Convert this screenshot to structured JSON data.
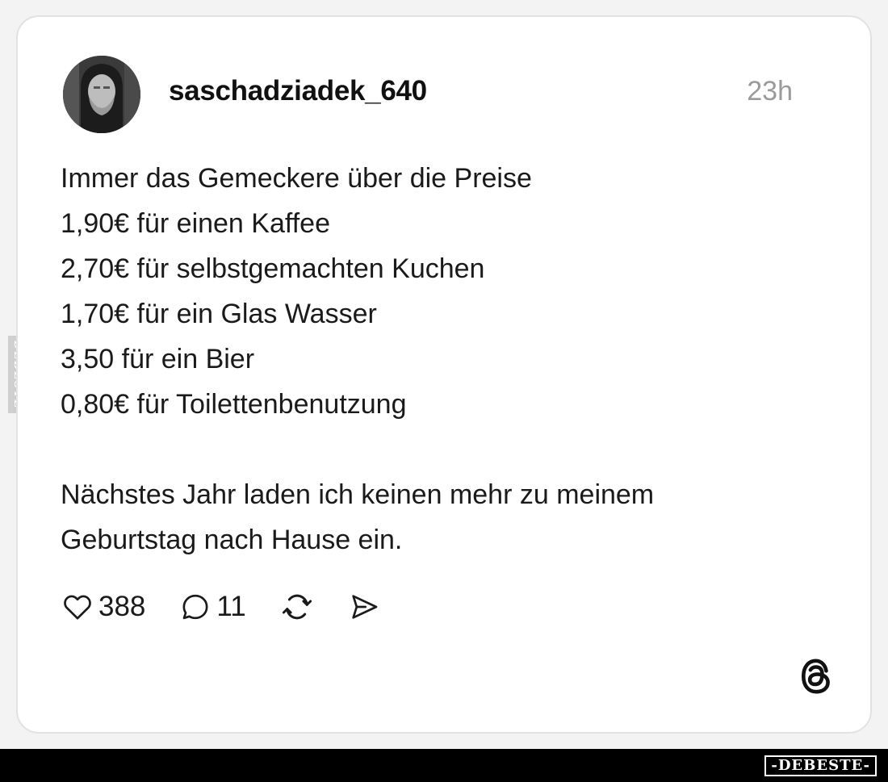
{
  "post": {
    "username": "saschadziadek_640",
    "timestamp": "23h",
    "lines": [
      "Immer das Gemeckere über die Preise",
      "1,90€ für einen Kaffee",
      "2,70€ für selbstgemachten Kuchen",
      "1,70€ für ein Glas Wasser",
      "3,50 für ein Bier",
      "0,80€ für Toilettenbenutzung"
    ],
    "closing_lines": [
      "Nächstes Jahr laden ich keinen mehr zu meinem",
      "Geburtstag nach Hause ein."
    ]
  },
  "actions": {
    "like_icon": "heart-icon",
    "like_count": "388",
    "reply_icon": "comment-icon",
    "reply_count": "11",
    "repost_icon": "repost-icon",
    "share_icon": "send-icon"
  },
  "branding": {
    "app_logo_icon": "threads-logo-icon",
    "side_watermark": "DEBESTE",
    "bottom_watermark": "-DEBESTE-"
  },
  "colors": {
    "text": "#1a1a1a",
    "muted": "#9a9a9a",
    "card_border": "#e2e2e2",
    "bar": "#000000"
  }
}
